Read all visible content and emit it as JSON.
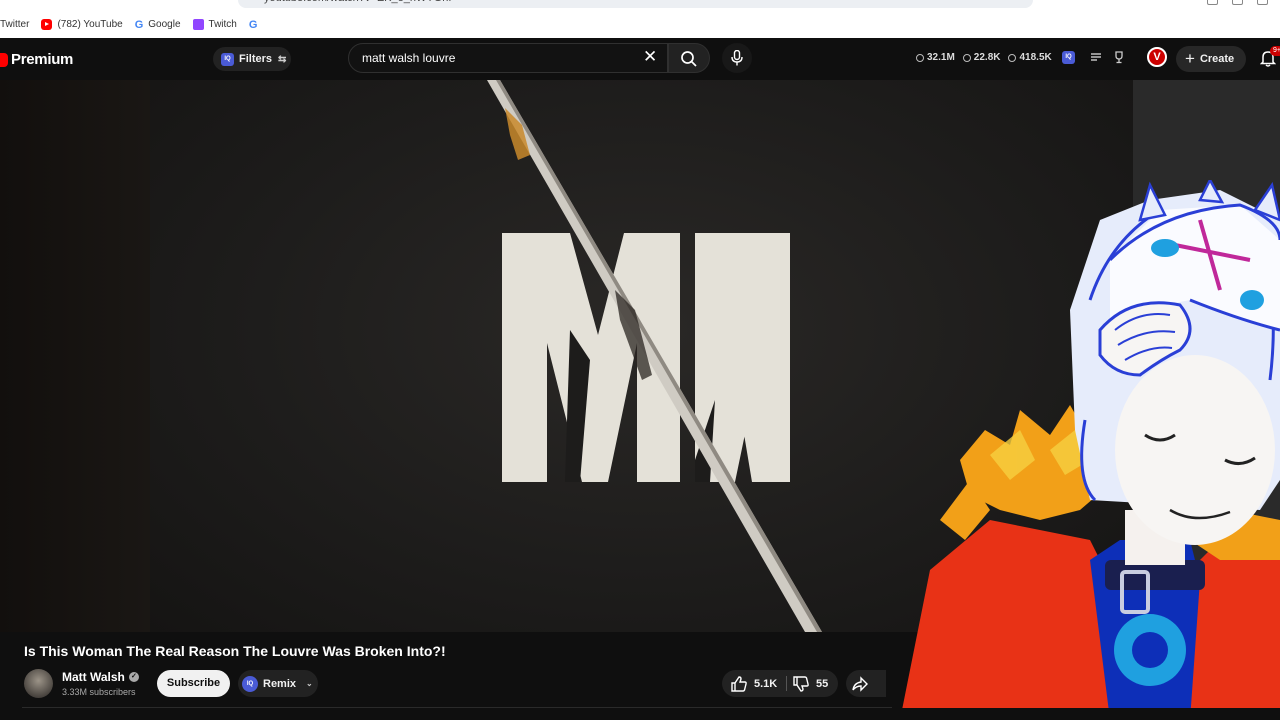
{
  "browser": {
    "url": "youtube.com/watch?v=EK_e_hWYGhI",
    "bookmarks": [
      {
        "label": "Twitter",
        "icon": "twitter-icon"
      },
      {
        "label": "(782) YouTube",
        "icon": "youtube-icon"
      },
      {
        "label": "Google",
        "icon": "google-icon"
      },
      {
        "label": "Twitch",
        "icon": "twitch-icon"
      },
      {
        "label": "",
        "icon": "google-icon"
      }
    ]
  },
  "header": {
    "logo_text": "Premium",
    "filters_label": "Filters",
    "iq_badge": "IQ",
    "search_value": "matt walsh louvre",
    "stats": [
      {
        "icon": "clock-icon",
        "value": "32.1M"
      },
      {
        "icon": "eye-icon",
        "value": "22.8K"
      },
      {
        "icon": "eye-icon",
        "value": "418.5K"
      }
    ],
    "avatar_letter": "V",
    "create_label": "Create",
    "notification_count": "9+"
  },
  "video": {
    "thumbnail_logo": "MW",
    "title": "Is This Woman The Real Reason The Louvre Was Broken Into?!",
    "channel_name": "Matt Walsh",
    "subscribers": "3.33M subscribers",
    "subscribe_label": "Subscribe",
    "remix_label": "Remix",
    "likes": "5.1K",
    "dislikes": "55"
  },
  "colors": {
    "brand_red": "#ff0000",
    "background": "#0f0f0f",
    "iq_badge": "#4a5bd6"
  }
}
